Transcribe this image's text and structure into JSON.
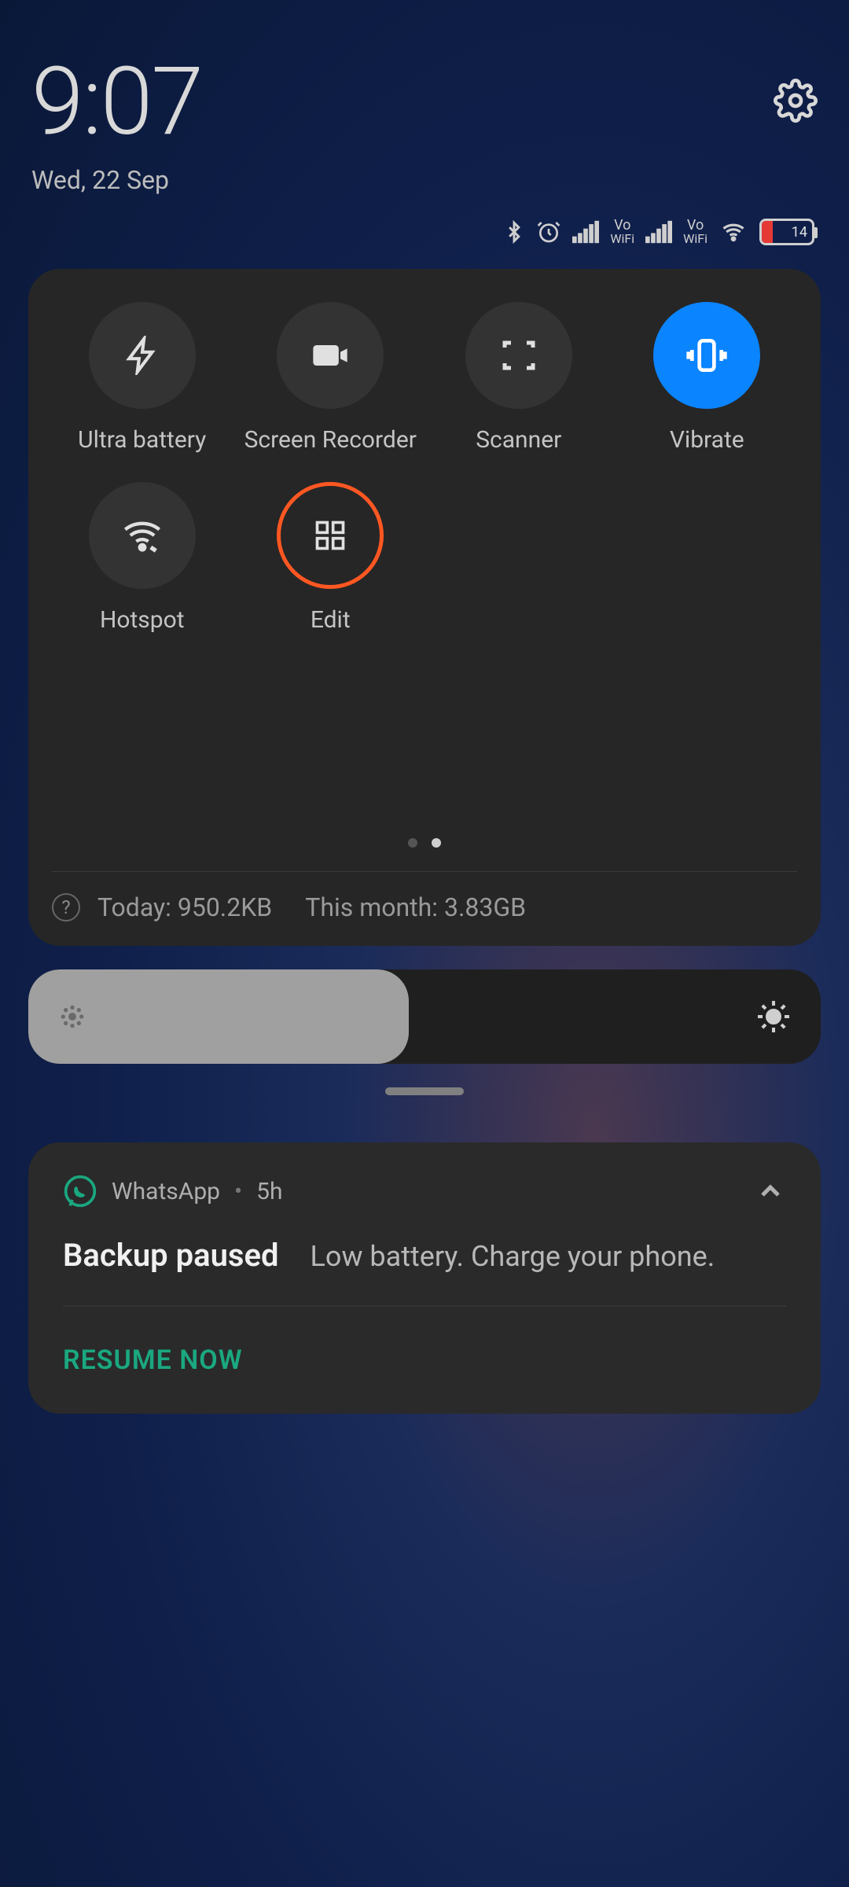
{
  "header": {
    "time": "9:07",
    "date": "Wed, 22 Sep"
  },
  "status": {
    "battery_level": "14"
  },
  "quick_panel": {
    "tiles": [
      {
        "label": "Ultra battery",
        "icon": "bolt",
        "state": "off"
      },
      {
        "label": "Screen Recorder",
        "icon": "video",
        "state": "off"
      },
      {
        "label": "Scanner",
        "icon": "scan",
        "state": "off"
      },
      {
        "label": "Vibrate",
        "icon": "vibrate",
        "state": "on"
      },
      {
        "label": "Hotspot",
        "icon": "hotspot",
        "state": "off"
      },
      {
        "label": "Edit",
        "icon": "grid",
        "state": "highlight"
      }
    ],
    "page_indicator": {
      "total": 2,
      "active": 1
    },
    "data_today": "Today: 950.2KB",
    "data_month": "This month: 3.83GB"
  },
  "brightness": {
    "percent": 48
  },
  "notification": {
    "app": "WhatsApp",
    "time_ago": "5h",
    "title": "Backup paused",
    "message": "Low battery. Charge your phone.",
    "action": "RESUME NOW"
  },
  "colors": {
    "accent_blue": "#0a84ff",
    "highlight_orange": "#ff5722",
    "action_teal": "#1aa880"
  }
}
